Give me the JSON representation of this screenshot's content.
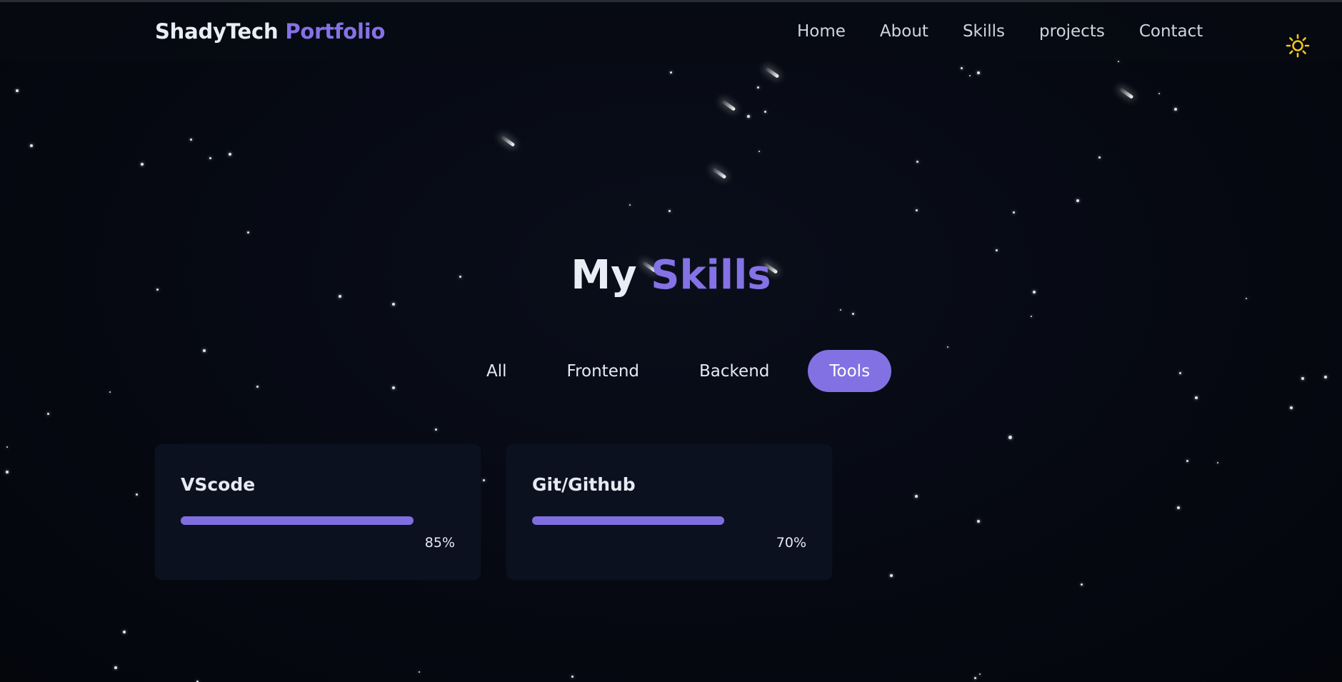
{
  "brand": {
    "name": "ShadyTech",
    "accent": "Portfolio"
  },
  "nav": {
    "items": [
      {
        "label": "Home"
      },
      {
        "label": "About"
      },
      {
        "label": "Skills"
      },
      {
        "label": "projects"
      },
      {
        "label": "Contact"
      }
    ],
    "theme_icon": "sun-icon"
  },
  "section": {
    "title_main": "My",
    "title_accent": "Skills"
  },
  "filters": {
    "items": [
      {
        "label": "All",
        "active": false
      },
      {
        "label": "Frontend",
        "active": false
      },
      {
        "label": "Backend",
        "active": false
      },
      {
        "label": "Tools",
        "active": true
      }
    ]
  },
  "skills": [
    {
      "name": "VScode",
      "percent": 85,
      "percent_label": "85%"
    },
    {
      "name": "Git/Github",
      "percent": 70,
      "percent_label": "70%"
    }
  ],
  "colors": {
    "accent": "#8472e6",
    "background": "#060911",
    "card": "#0c1120",
    "sun": "#f5c518"
  }
}
